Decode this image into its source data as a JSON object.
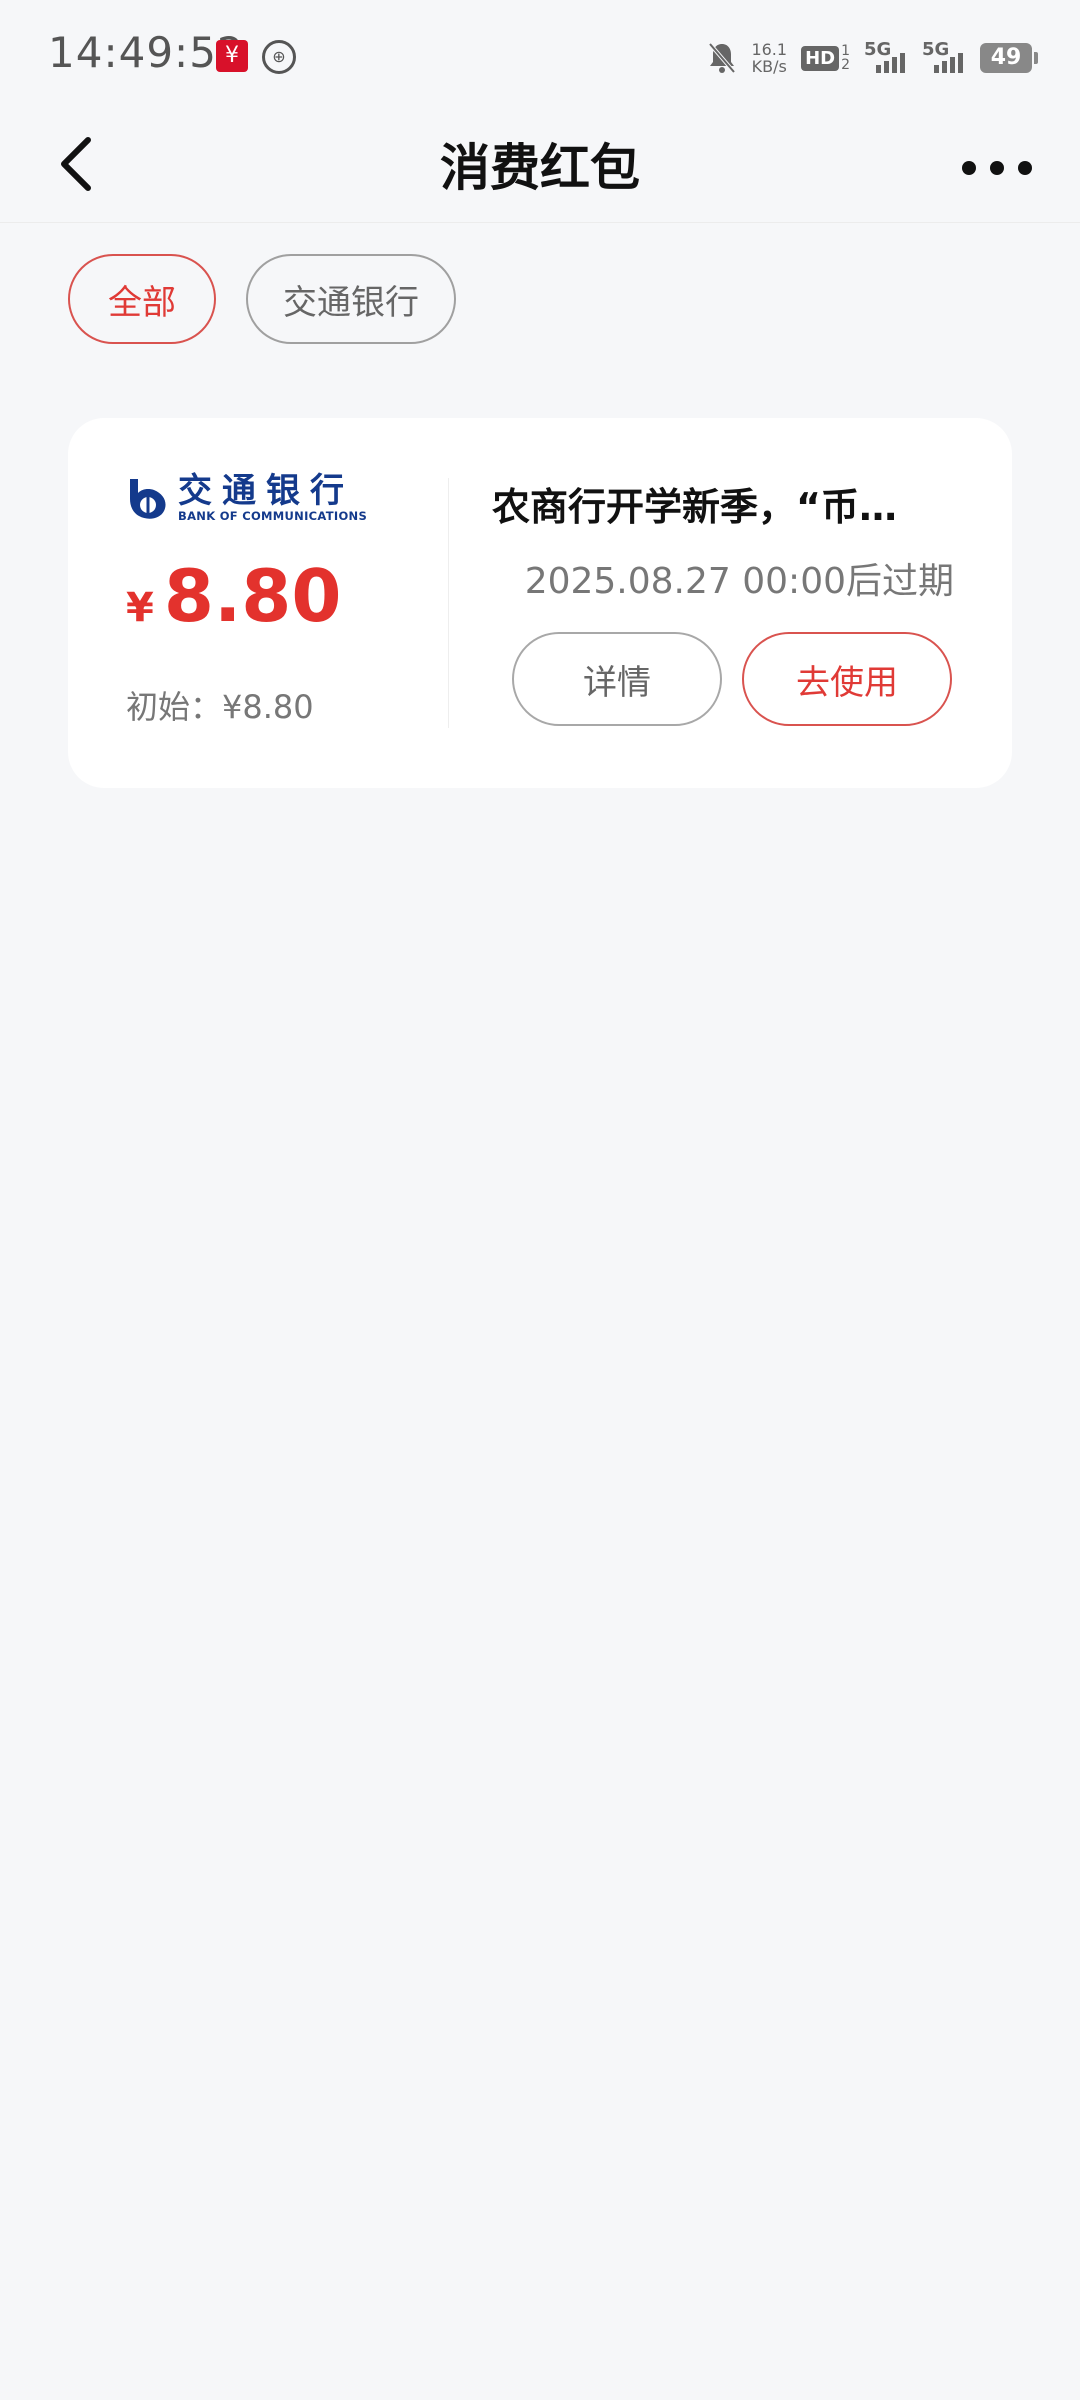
{
  "status_bar": {
    "time": "14:49:52",
    "net_speed_value": "16.1",
    "net_speed_unit": "KB/s",
    "hd_label": "HD",
    "sim_label": "1\n2",
    "signal_1_label": "5G",
    "signal_2_label": "5G",
    "battery": "49",
    "icons": [
      "digital-rmb-app-icon",
      "currency-app-icon",
      "bell-muted-icon",
      "signal-icon",
      "battery-icon"
    ]
  },
  "nav": {
    "title": "消费红包",
    "back_icon": "chevron-left-icon",
    "more_icon": "more-dots-icon"
  },
  "filters": [
    {
      "label": "全部",
      "active": true
    },
    {
      "label": "交通银行",
      "active": false
    }
  ],
  "coupon": {
    "bank_name_cn": "交通银行",
    "bank_name_en": "BANK OF COMMUNICATIONS",
    "currency_symbol": "¥",
    "amount": "8.80",
    "initial_text": "初始：¥8.80",
    "title": "农商行开学新季，“币…",
    "expiry": "2025.08.27 00:00后过期",
    "detail_label": "详情",
    "use_label": "去使用"
  },
  "colors": {
    "accent_red": "#e03a36",
    "bank_blue": "#143a8c",
    "background": "#f6f7f9"
  }
}
